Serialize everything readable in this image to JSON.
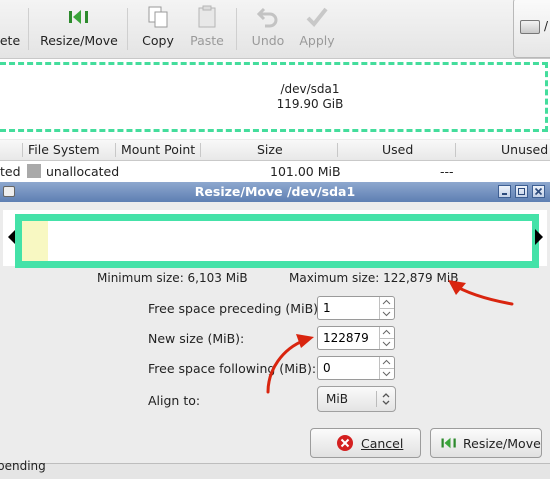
{
  "toolbar": {
    "items": [
      {
        "label": "ete",
        "icon": "delete-icon",
        "enabled": true
      },
      {
        "label": "Resize/Move",
        "icon": "resize-move-icon",
        "enabled": true
      },
      {
        "label": "Copy",
        "icon": "copy-icon",
        "enabled": true
      },
      {
        "label": "Paste",
        "icon": "paste-icon",
        "enabled": false
      },
      {
        "label": "Undo",
        "icon": "undo-icon",
        "enabled": false
      },
      {
        "label": "Apply",
        "icon": "apply-icon",
        "enabled": false
      }
    ],
    "device_selector_text": "/"
  },
  "graph": {
    "partition_path": "/dev/sda1",
    "partition_size": "119.90 GiB",
    "accent": "#44dd9c"
  },
  "list": {
    "columns": [
      "File System",
      "Mount Point",
      "Size",
      "Used",
      "Unused"
    ],
    "rows": [
      {
        "partition": "ted",
        "filesystem": "unallocated",
        "mount_point": "",
        "size": "101.00 MiB",
        "used": "---",
        "unused": ""
      }
    ]
  },
  "dialog": {
    "title": "Resize/Move /dev/sda1",
    "minimum_size": "Minimum size: 6,103 MiB",
    "maximum_size": "Maximum size: 122,879 MiB",
    "fields": {
      "free_preceding": {
        "label": "Free space preceding (MiB):",
        "value": "1"
      },
      "new_size": {
        "label": "New size (MiB):",
        "value": "122879"
      },
      "free_following": {
        "label": "Free space following (MiB):",
        "value": "0"
      },
      "align_to": {
        "label": "Align to:",
        "value": "MiB"
      }
    },
    "buttons": {
      "cancel": "Cancel",
      "resize_move": "Resize/Move"
    },
    "frame_color": "#44e2a8",
    "used_color": "#f8f8c2"
  },
  "status": {
    "text": "pending"
  }
}
